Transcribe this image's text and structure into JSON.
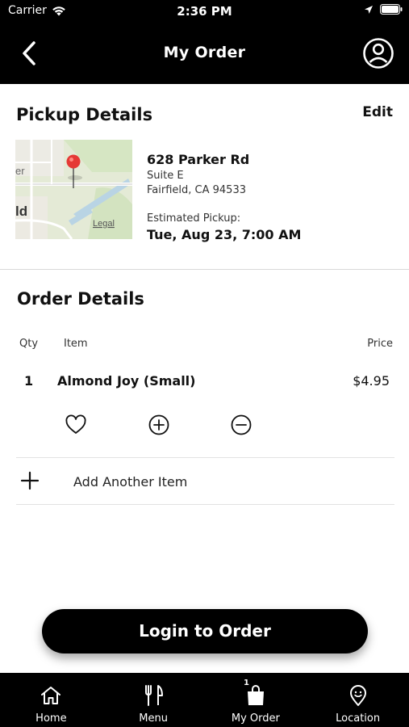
{
  "status_bar": {
    "carrier": "Carrier",
    "time": "2:36 PM"
  },
  "nav": {
    "title": "My Order"
  },
  "pickup": {
    "heading": "Pickup Details",
    "edit_label": "Edit",
    "map_legal": "Legal",
    "map_city_fragment": "ld",
    "map_edge_fragment": "er",
    "street": "628 Parker Rd",
    "suite": "Suite E",
    "city": "Fairfield, CA 94533",
    "estimated_label": "Estimated Pickup:",
    "estimated_time": "Tue, Aug 23, 7:00 AM"
  },
  "order": {
    "heading": "Order Details",
    "columns": {
      "qty": "Qty",
      "item": "Item",
      "price": "Price"
    },
    "items": [
      {
        "qty": "1",
        "name": "Almond Joy (Small)",
        "price": "$4.95"
      }
    ],
    "add_item_label": "Add Another Item"
  },
  "login_button": "Login to Order",
  "tabs": [
    {
      "label": "Home",
      "icon": "home-icon"
    },
    {
      "label": "Menu",
      "icon": "utensils-icon"
    },
    {
      "label": "My Order",
      "icon": "bag-icon",
      "badge": "1"
    },
    {
      "label": "Location",
      "icon": "location-pin-icon"
    }
  ]
}
